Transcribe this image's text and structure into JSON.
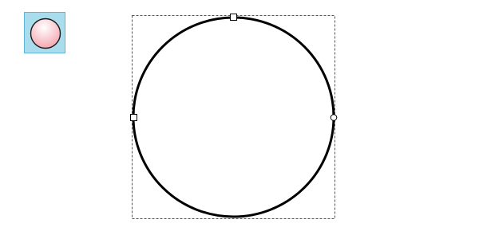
{
  "toolbar": {
    "active_tool": "ellipse-tool",
    "button_fill": "#a9dced",
    "button_border": "#5fb7d6",
    "icon_gradient": [
      "#ffffff",
      "#f4a7b1"
    ]
  },
  "shape": {
    "type": "circle",
    "stroke": "#000000",
    "fill": "#ffffff",
    "selected": true,
    "handles": [
      "top-square",
      "left-square",
      "right-circle"
    ]
  }
}
